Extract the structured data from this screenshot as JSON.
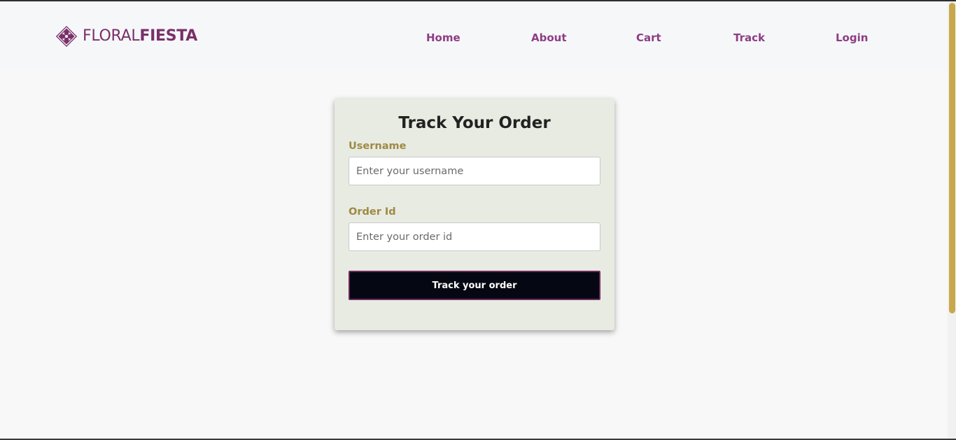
{
  "brand": {
    "name_light": "FLORAL",
    "name_bold": "FIESTA",
    "logo_icon": "floral-diamond-icon",
    "color": "#7a2f6a"
  },
  "nav": {
    "items": [
      {
        "label": "Home"
      },
      {
        "label": "About"
      },
      {
        "label": "Cart"
      },
      {
        "label": "Track"
      },
      {
        "label": "Login"
      }
    ],
    "color": "#8e3d84"
  },
  "form": {
    "title": "Track Your Order",
    "username": {
      "label": "Username",
      "placeholder": "Enter your username",
      "value": ""
    },
    "order_id": {
      "label": "Order Id",
      "placeholder": "Enter your order id",
      "value": ""
    },
    "submit_label": "Track your order"
  },
  "colors": {
    "label": "#9e8a45",
    "card_background": "#e8ebe1",
    "button_background": "#050812",
    "button_border": "#6e2a5c",
    "scroll_thumb": "#c8a84a"
  }
}
